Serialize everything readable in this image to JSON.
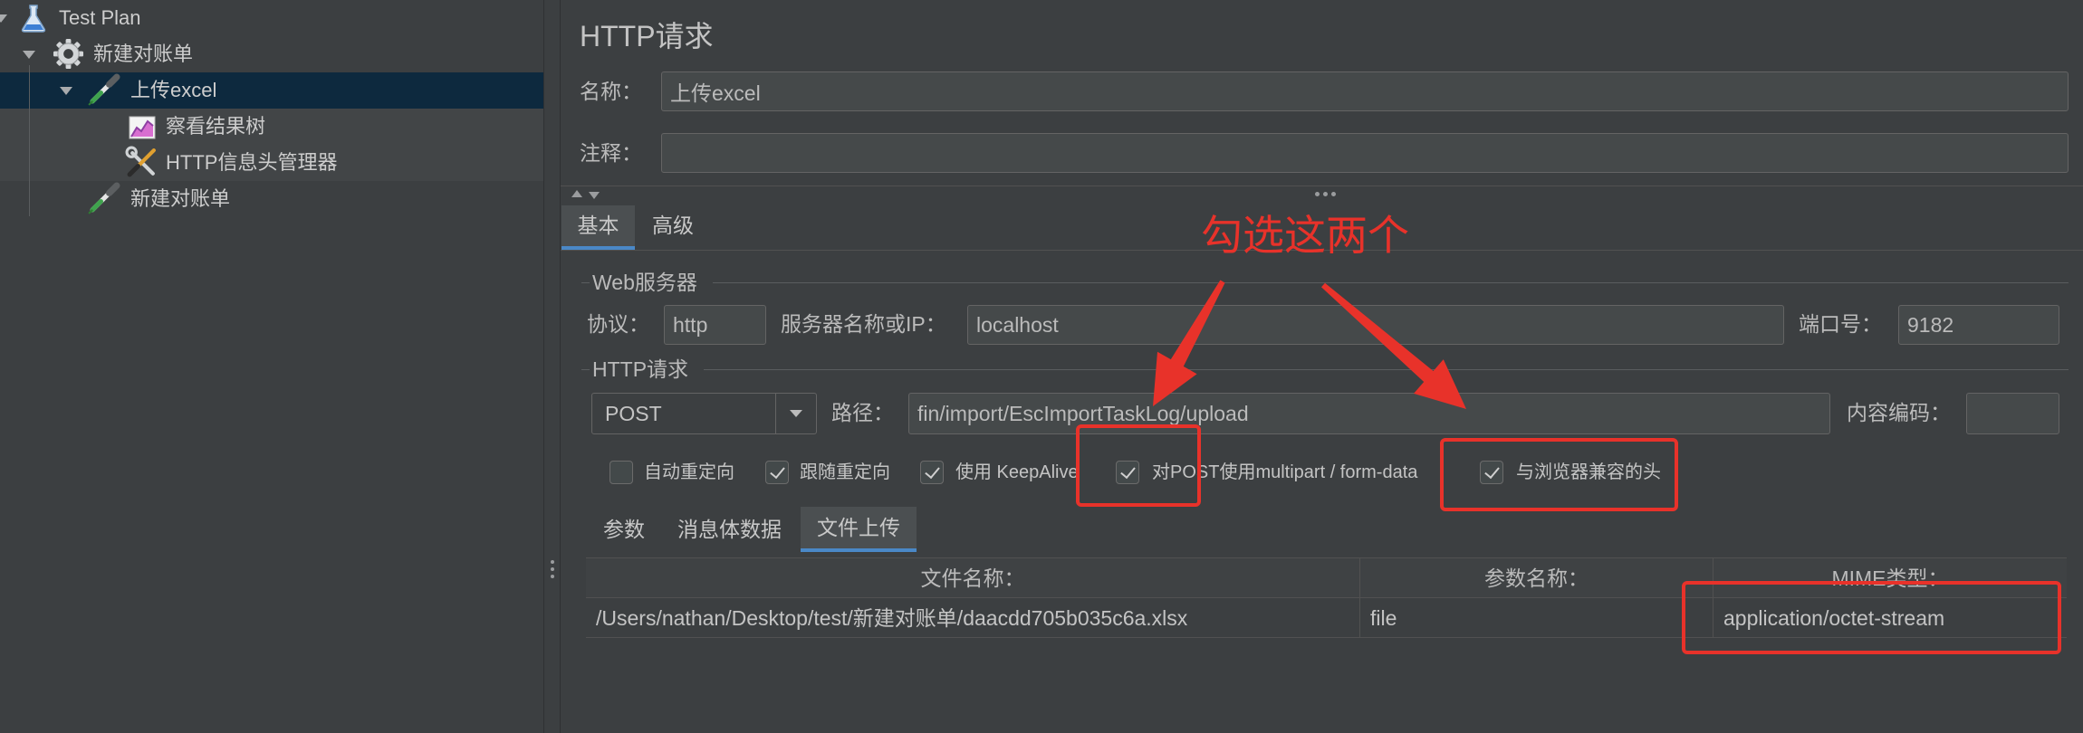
{
  "tree": {
    "items": [
      {
        "label": "Test Plan",
        "icon": "flask-icon",
        "expanded": true,
        "selected": false
      },
      {
        "label": "新建对账单",
        "icon": "gear-icon",
        "expanded": true,
        "selected": false
      },
      {
        "label": "上传excel",
        "icon": "pipette-icon",
        "expanded": true,
        "selected": true
      },
      {
        "label": "察看结果树",
        "icon": "chart-icon",
        "selected": false
      },
      {
        "label": "HTTP信息头管理器",
        "icon": "tools-icon",
        "selected": false
      },
      {
        "label": "新建对账单",
        "icon": "pipette-icon",
        "selected": false
      }
    ]
  },
  "panel": {
    "title": "HTTP请求",
    "name": {
      "label": "名称：",
      "value": "上传excel"
    },
    "comment": {
      "label": "注释：",
      "value": ""
    },
    "tabs": [
      {
        "label": "基本",
        "active": true
      },
      {
        "label": "高级",
        "active": false
      }
    ]
  },
  "web_server": {
    "group_label": "Web服务器",
    "protocol": {
      "label": "协议：",
      "value": "http"
    },
    "server": {
      "label": "服务器名称或IP：",
      "value": "localhost"
    },
    "port": {
      "label": "端口号：",
      "value": "9182"
    }
  },
  "http_request": {
    "group_label": "HTTP请求",
    "method": {
      "value": "POST"
    },
    "path": {
      "label": "路径：",
      "value": "fin/import/EscImportTaskLog/upload"
    },
    "encoding": {
      "label": "内容编码：",
      "value": ""
    },
    "options": [
      {
        "label": "自动重定向",
        "checked": false
      },
      {
        "label": "跟随重定向",
        "checked": true
      },
      {
        "label": "使用 KeepAlive",
        "checked": true
      },
      {
        "label": "对POST使用multipart / form-data",
        "checked": true
      },
      {
        "label": "与浏览器兼容的头",
        "checked": true
      }
    ]
  },
  "sub_tabs": [
    {
      "label": "参数",
      "active": false
    },
    {
      "label": "消息体数据",
      "active": false
    },
    {
      "label": "文件上传",
      "active": true
    }
  ],
  "files_table": {
    "headers": [
      "文件名称：",
      "参数名称：",
      "MIME类型："
    ],
    "rows": [
      [
        "/Users/nathan/Desktop/test/新建对账单/daacdd705b035c6a.xlsx",
        "file",
        "application/octet-stream"
      ]
    ]
  },
  "annotation": {
    "text": "勾选这两个",
    "color": "#e8322a"
  },
  "theme": {
    "background": "#3c3f41",
    "text": "#bbbbbb",
    "accent": "#4a88c7",
    "selection": "#0d293e",
    "field": "#45494a"
  }
}
